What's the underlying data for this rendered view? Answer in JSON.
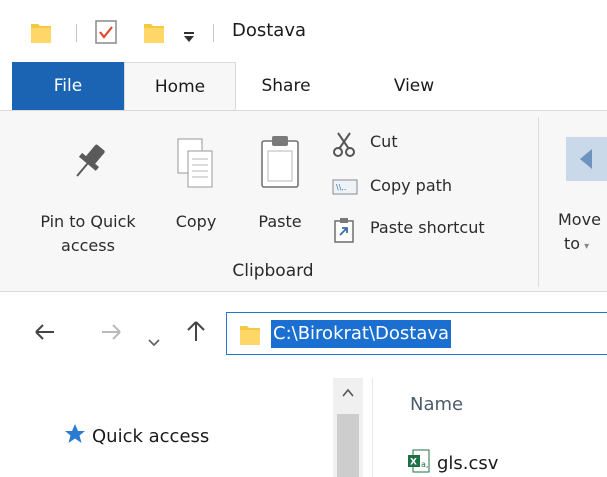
{
  "titlebar": {
    "title": "Dostava",
    "icons": [
      "folder-icon",
      "properties-check-icon",
      "new-folder-icon",
      "customize-dropdown-icon"
    ]
  },
  "ribbon_tabs": [
    {
      "label": "File",
      "active": false,
      "accent": "#1b64b3"
    },
    {
      "label": "Home",
      "active": true
    },
    {
      "label": "Share",
      "active": false
    },
    {
      "label": "View",
      "active": false
    }
  ],
  "clipboard": {
    "group_label": "Clipboard",
    "pin_line1": "Pin to Quick",
    "pin_line2": "access",
    "copy": "Copy",
    "paste": "Paste",
    "cut": "Cut",
    "copy_path": "Copy path",
    "paste_shortcut": "Paste shortcut"
  },
  "organize": {
    "move_line1": "Move",
    "move_line2": "to"
  },
  "navigation": {
    "back_icon": "back-arrow-icon",
    "forward_icon": "forward-arrow-icon",
    "recent_icon": "chevron-down-icon",
    "up_icon": "up-arrow-icon"
  },
  "address": {
    "path": "C:\\Birokrat\\Dostava",
    "selection_color": "#1a6fd1"
  },
  "navpane": {
    "quick_access": "Quick access"
  },
  "file_list": {
    "column_name": "Name",
    "files": [
      {
        "name": "gls.csv",
        "icon": "excel-csv-icon"
      }
    ]
  }
}
